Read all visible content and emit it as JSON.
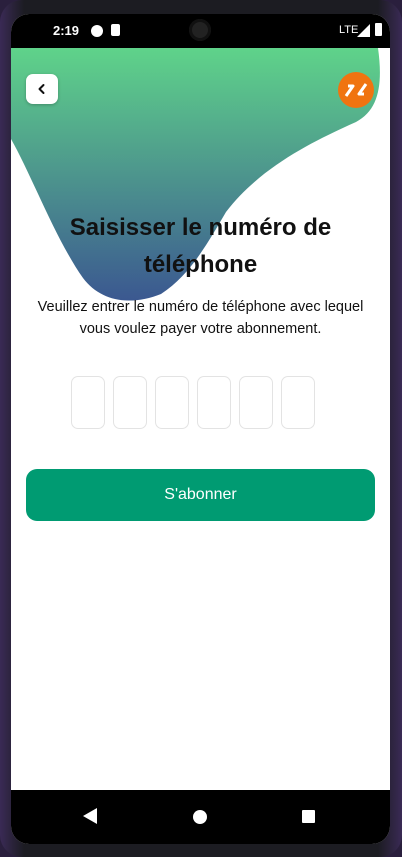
{
  "status_bar": {
    "time": "2:19",
    "network": "LTE"
  },
  "header": {
    "back_icon": "chevron-left-icon",
    "logo_icon": "brand-logo-icon"
  },
  "main": {
    "title": "Saisisser le numéro de téléphone",
    "subtitle": "Veuillez entrer le numéro de téléphone avec lequel vous voulez payer votre abonnement.",
    "code_fields": [
      "",
      "",
      "",
      "",
      "",
      ""
    ],
    "subscribe_label": "S'abonner"
  },
  "colors": {
    "gradient_top": "#5fd38a",
    "gradient_bottom": "#3b5890",
    "primary_button": "#009b72",
    "logo": "#f07410"
  }
}
